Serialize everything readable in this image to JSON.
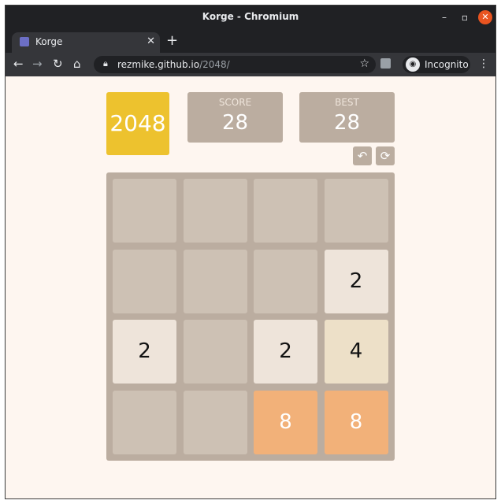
{
  "browser": {
    "window_title": "Korge - Chromium",
    "tab_title": "Korge",
    "url_host": "rezmike.github.io",
    "url_path": "/2048/",
    "incognito_label": "Incognito"
  },
  "game": {
    "logo": "2048",
    "score_label": "SCORE",
    "score_value": "28",
    "best_label": "BEST",
    "best_value": "28",
    "board": [
      [
        "",
        "",
        "",
        ""
      ],
      [
        "",
        "",
        "",
        "2"
      ],
      [
        "2",
        "",
        "2",
        "4"
      ],
      [
        "",
        "",
        "8",
        "8"
      ]
    ]
  },
  "colors": {
    "logo": "#edc22e",
    "board": "#bbada0",
    "empty_cell": "#cdc1b4",
    "tile_2": "#eee4da",
    "tile_4": "#ede0c8",
    "tile_8": "#f2b179",
    "page_background": "#fef6f0"
  },
  "icons": {
    "undo": "undo-icon",
    "restart": "restart-icon"
  }
}
